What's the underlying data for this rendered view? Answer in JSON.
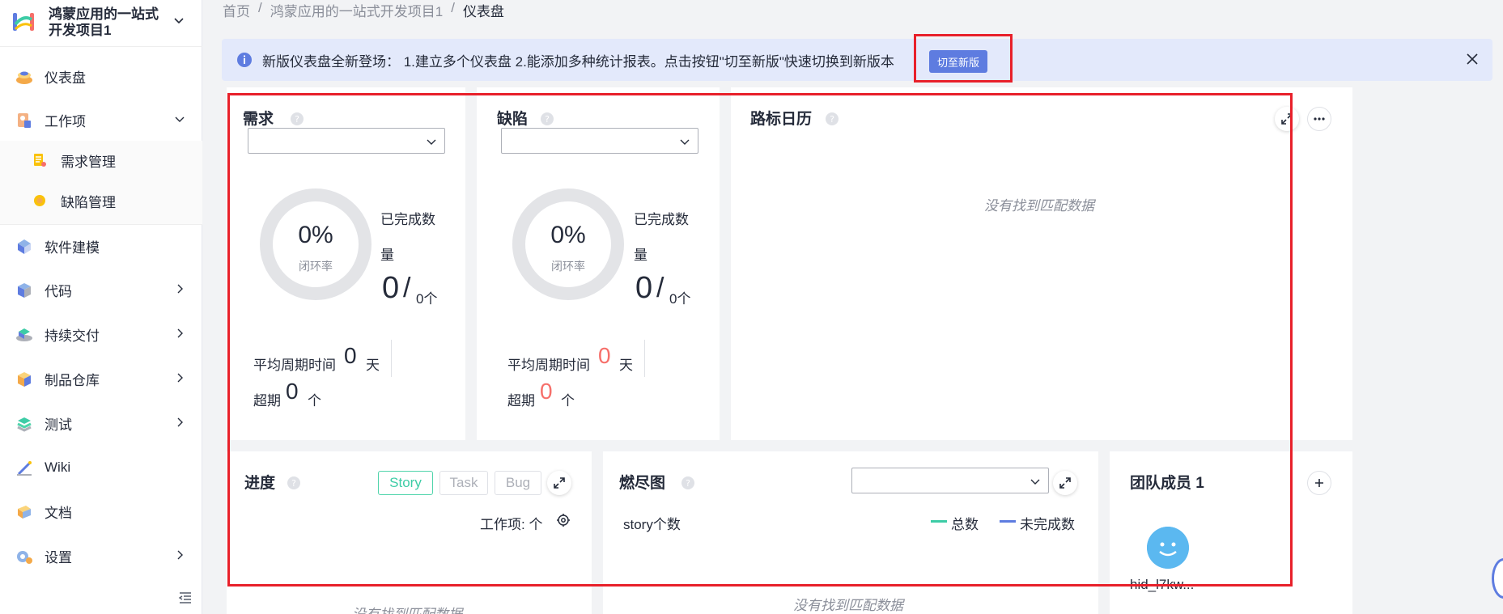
{
  "sidebar": {
    "project_name": "鸿蒙应用的一站式开发项目1",
    "items": [
      {
        "label": "仪表盘",
        "icon": "dashboard-icon"
      },
      {
        "label": "工作项",
        "icon": "workitem-icon"
      },
      {
        "label": "需求管理",
        "icon": "requirement-icon"
      },
      {
        "label": "缺陷管理",
        "icon": "defect-icon"
      },
      {
        "label": "软件建模",
        "icon": "modeling-icon"
      },
      {
        "label": "代码",
        "icon": "code-icon"
      },
      {
        "label": "持续交付",
        "icon": "delivery-icon"
      },
      {
        "label": "制品仓库",
        "icon": "artifact-icon"
      },
      {
        "label": "测试",
        "icon": "test-icon"
      },
      {
        "label": "Wiki",
        "icon": "wiki-icon"
      },
      {
        "label": "文档",
        "icon": "docs-icon"
      },
      {
        "label": "设置",
        "icon": "settings-icon"
      }
    ]
  },
  "breadcrumb": {
    "home": "首页",
    "sep": "/",
    "project": "鸿蒙应用的一站式开发项目1",
    "current": "仪表盘"
  },
  "alert": {
    "text": "新版仪表盘全新登场： 1.建立多个仪表盘 2.能添加多种统计报表。点击按钮\"切至新版\"快速切换到新版本",
    "button": "切至新版"
  },
  "req_card": {
    "title": "需求",
    "percent": "0%",
    "rate_label": "闭环率",
    "done_label": "已完成数量",
    "done_num": "0",
    "slash": "/",
    "total": "0个",
    "cycle_label": "平均周期时间",
    "cycle_value": "0",
    "cycle_unit": "天",
    "overdue_label": "超期",
    "overdue_value": "0",
    "overdue_unit": "个"
  },
  "bug_card": {
    "title": "缺陷",
    "percent": "0%",
    "rate_label": "闭环率",
    "done_label": "已完成数量",
    "done_num": "0",
    "slash": "/",
    "total": "0个",
    "cycle_label": "平均周期时间",
    "cycle_value": "0",
    "cycle_unit": "天",
    "overdue_label": "超期",
    "overdue_value": "0",
    "overdue_unit": "个"
  },
  "milestone_card": {
    "title": "路标日历",
    "empty": "没有找到匹配数据"
  },
  "progress_card": {
    "title": "进度",
    "tabs": [
      "Story",
      "Task",
      "Bug"
    ],
    "workitem_label": "工作项: 个",
    "empty": "没有找到匹配数据"
  },
  "burndown_card": {
    "title": "燃尽图",
    "ylabel": "story个数",
    "legend_total": "总数",
    "legend_open": "未完成数",
    "legend_total_color": "#3dcca6",
    "legend_open_color": "#5e7ce0",
    "empty": "没有找到匹配数据"
  },
  "team_card": {
    "title": "团队成员 1",
    "member_name": "hid_l7kw..."
  }
}
